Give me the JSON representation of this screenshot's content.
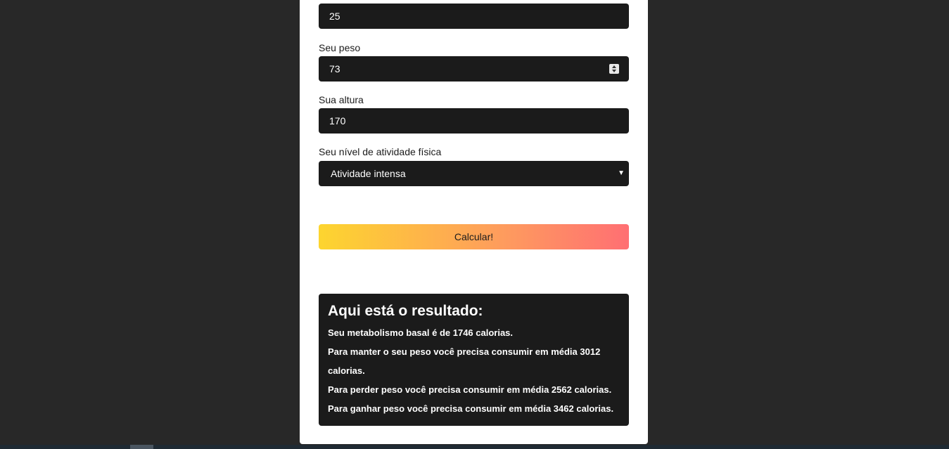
{
  "form": {
    "age_value": "25",
    "weight_label": "Seu peso",
    "weight_value": "73",
    "height_label": "Sua altura",
    "height_value": "170",
    "activity_label": "Seu nível de atividade física",
    "activity_selected": "Atividade intensa",
    "submit_label": "Calcular!"
  },
  "result": {
    "title": "Aqui está o resultado:",
    "basal": "Seu metabolismo basal é de 1746 calorias.",
    "maintain": "Para manter o seu peso você precisa consumir em média 3012 calorias.",
    "lose": "Para perder peso você precisa consumir em média 2562 calorias.",
    "gain": "Para ganhar peso você precisa consumir em média 3462 calorias."
  },
  "colors": {
    "page_bg": "#282828",
    "card_bg": "#ffffff",
    "field_bg": "#1b1b1b",
    "gradient_start": "#fdd52f",
    "gradient_end": "#ff6f73"
  }
}
